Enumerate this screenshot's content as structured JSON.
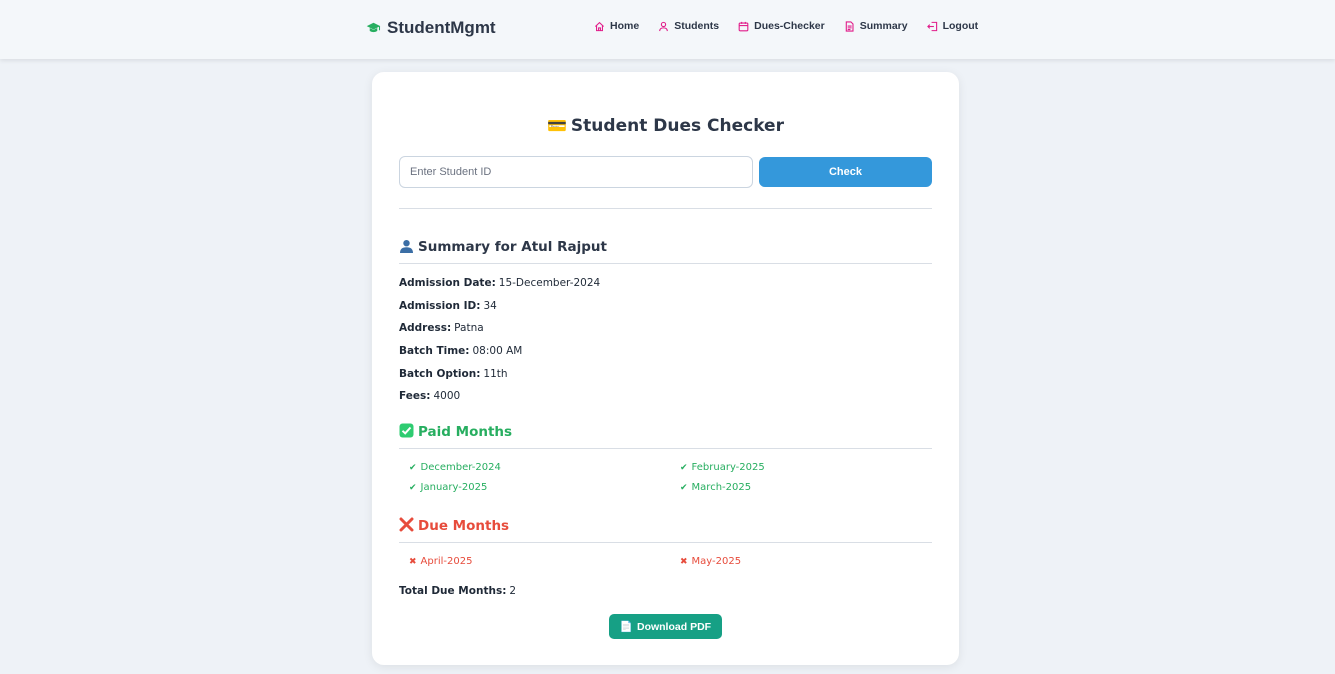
{
  "nav": {
    "brand": "StudentMgmt",
    "links": [
      {
        "label": "Home",
        "icon": "home-icon"
      },
      {
        "label": "Students",
        "icon": "user-icon"
      },
      {
        "label": "Dues-Checker",
        "icon": "calendar-icon"
      },
      {
        "label": "Summary",
        "icon": "document-icon"
      },
      {
        "label": "Logout",
        "icon": "logout-icon"
      }
    ]
  },
  "checker": {
    "title": "Student Dues Checker",
    "title_emoji": "💳",
    "input_placeholder": "Enter Student ID",
    "input_value": "",
    "check_label": "Check"
  },
  "summary": {
    "heading": "Summary for Atul Rajput",
    "fields": [
      {
        "label": "Admission Date:",
        "value": "15-December-2024"
      },
      {
        "label": "Admission ID:",
        "value": "34"
      },
      {
        "label": "Address:",
        "value": "Patna"
      },
      {
        "label": "Batch Time:",
        "value": "08:00 AM"
      },
      {
        "label": "Batch Option:",
        "value": "11th"
      },
      {
        "label": "Fees:",
        "value": "4000"
      }
    ]
  },
  "paid": {
    "heading": "Paid Months",
    "marker": "✔",
    "months": [
      "December-2024",
      "January-2025",
      "February-2025",
      "March-2025"
    ]
  },
  "due": {
    "heading": "Due Months",
    "marker": "✖",
    "months": [
      "April-2025",
      "May-2025"
    ]
  },
  "total": {
    "label": "Total Due Months:",
    "value": "2"
  },
  "download": {
    "label": "Download PDF",
    "icon": "📄"
  },
  "colors": {
    "accent": "#e11d8a",
    "check_button": "#3498db",
    "paid": "#27ae60",
    "due": "#e74c3c",
    "pdf_button": "#16a085",
    "brand_icon": "#27ae60"
  }
}
